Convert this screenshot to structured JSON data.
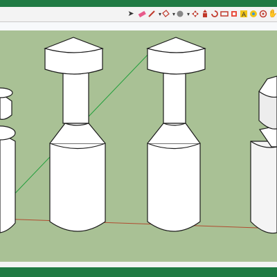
{
  "app": {
    "frame_color": "#1f7a43"
  },
  "toolbar": {
    "tools": [
      {
        "name": "select-tool",
        "icon": "arrow-cursor"
      },
      {
        "name": "eraser-tool",
        "icon": "eraser"
      },
      {
        "name": "pencil-tool",
        "icon": "pencil"
      },
      {
        "name": "paint-bucket-tool",
        "icon": "paint-bucket"
      },
      {
        "name": "circle-tool",
        "icon": "circle"
      },
      {
        "name": "move-tool",
        "icon": "move-arrows"
      },
      {
        "name": "push-pull-tool",
        "icon": "push-pull"
      },
      {
        "name": "rotate-tool",
        "icon": "rotate"
      },
      {
        "name": "scale-tool",
        "icon": "scale"
      },
      {
        "name": "tape-measure-tool",
        "icon": "tape-measure"
      },
      {
        "name": "text-tool",
        "icon": "text"
      },
      {
        "name": "paint-tool",
        "icon": "paint"
      },
      {
        "name": "orbit-tool",
        "icon": "orbit"
      },
      {
        "name": "pan-tool",
        "icon": "hand"
      }
    ]
  },
  "viewport": {
    "sky_color": "#f7f9fb",
    "ground_color": "#a9c195",
    "model_fill": "#ffffff",
    "model_shade": "#e3e3e3",
    "outline_color": "#1a1a1a",
    "axis_green": "#1f9e3a",
    "axis_red": "#b04a2e"
  }
}
